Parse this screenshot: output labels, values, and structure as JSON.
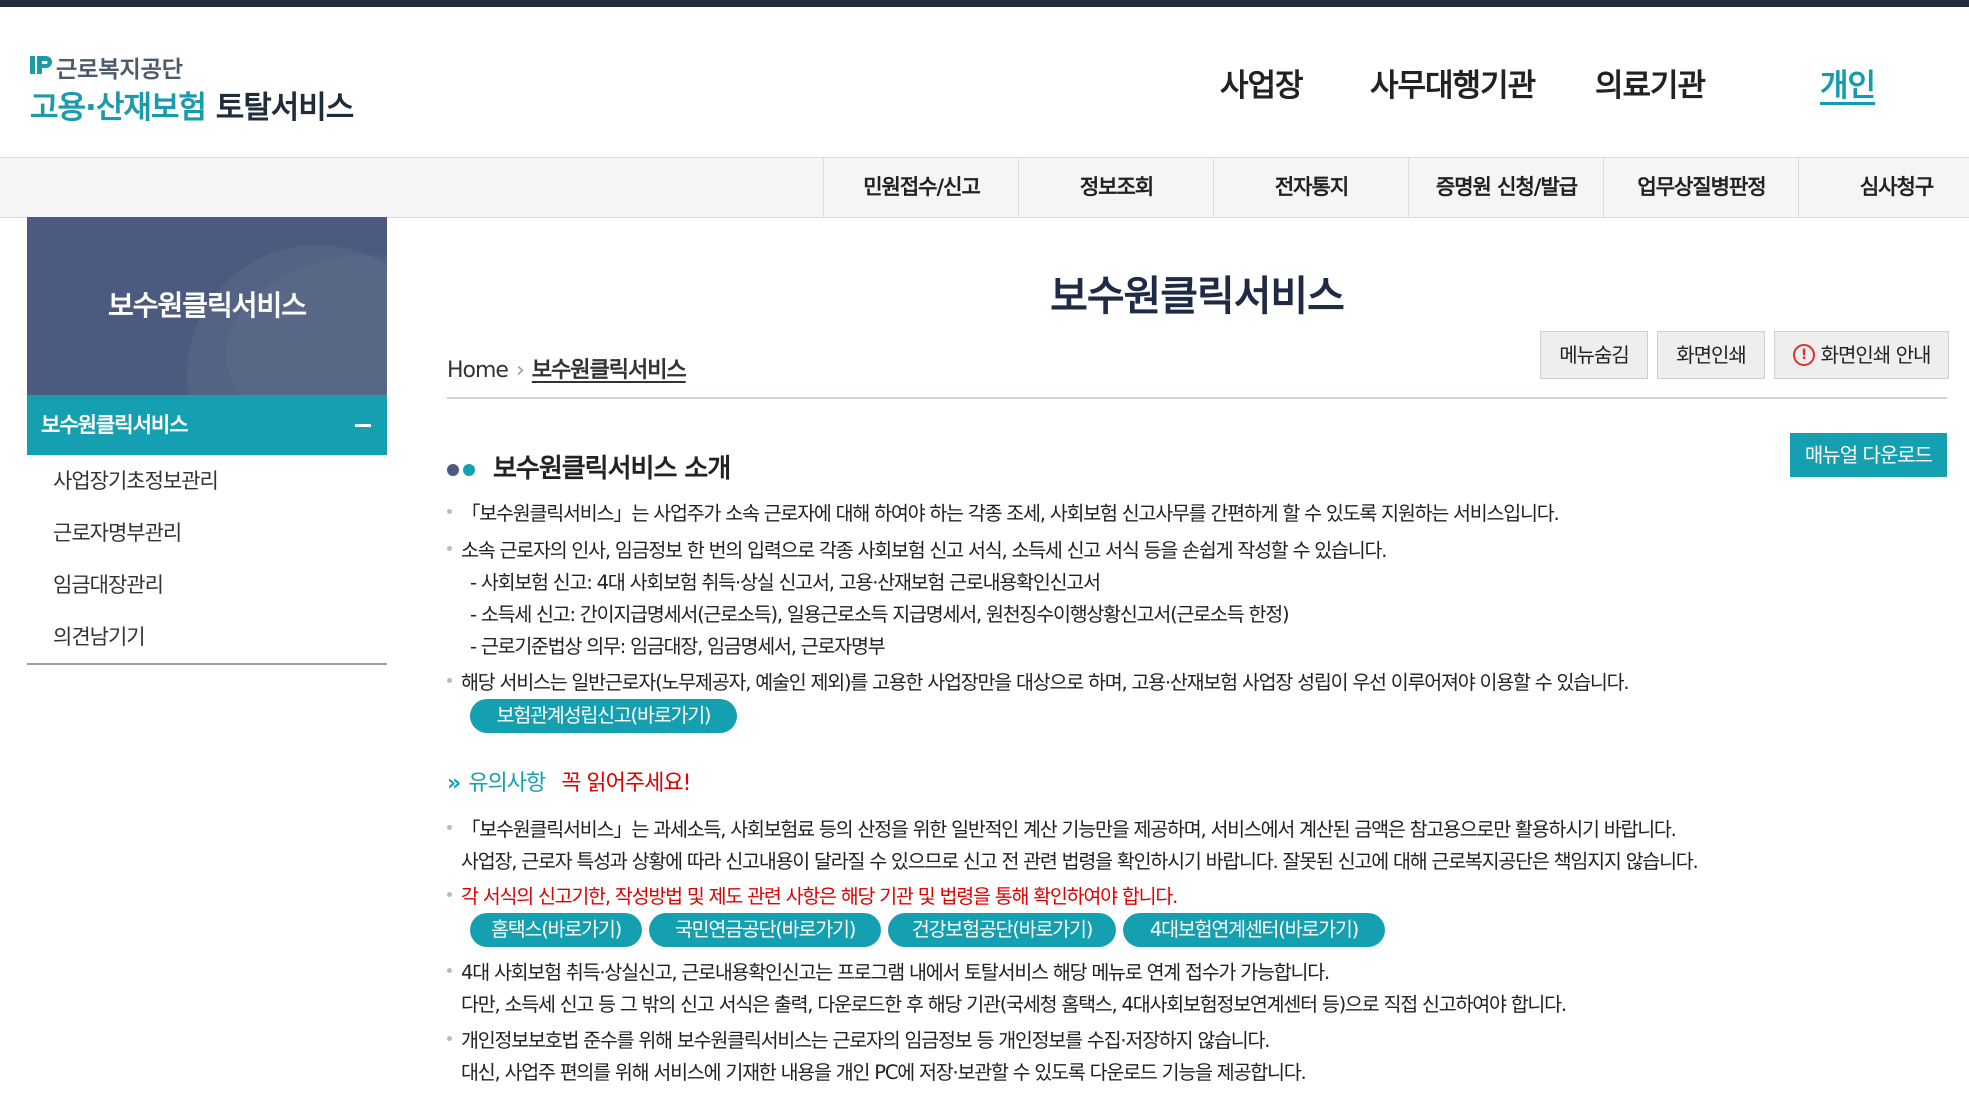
{
  "logo": {
    "org": "근로복지공단",
    "service_main": "고용·산재보험",
    "service_sub": "토탈서비스"
  },
  "top_nav": [
    "사업장",
    "사무대행기관",
    "의료기관",
    "개인"
  ],
  "sub_nav": [
    "민원접수/신고",
    "정보조회",
    "전자통지",
    "증명원 신청/발급",
    "업무상질병판정",
    "심사청구"
  ],
  "sidebar": {
    "title": "보수원클릭서비스",
    "active": "보수원클릭서비스",
    "items": [
      "사업장기초정보관리",
      "근로자명부관리",
      "임금대장관리",
      "의견남기기"
    ]
  },
  "page": {
    "title": "보수원클릭서비스",
    "breadcrumb_home": "Home",
    "breadcrumb_current": "보수원클릭서비스",
    "tools": {
      "hide_menu": "메뉴숨김",
      "print": "화면인쇄",
      "print_guide": "화면인쇄 안내"
    }
  },
  "manual_download": "매뉴얼 다운로드",
  "intro": {
    "title": "보수원클릭서비스 소개",
    "line1": "「보수원클릭서비스」는 사업주가 소속 근로자에 대해 하여야 하는 각종 조세, 사회보험 신고사무를 간편하게 할 수 있도록 지원하는 서비스입니다.",
    "line2": "소속 근로자의 인사, 임금정보 한 번의 입력으로 각종 사회보험 신고 서식, 소득세 신고 서식 등을 손쉽게 작성할 수 있습니다.",
    "sub1": "- 사회보험 신고: 4대 사회보험 취득·상실 신고서, 고용·산재보험 근로내용확인신고서",
    "sub2": "- 소득세 신고: 간이지급명세서(근로소득), 일용근로소득 지급명세서, 원천징수이행상황신고서(근로소득 한정)",
    "sub3": "- 근로기준법상 의무: 임금대장, 임금명세서, 근로자명부",
    "line3": "해당 서비스는 일반근로자(노무제공자, 예술인 제외)를 고용한 사업장만을 대상으로 하며, 고용·산재보험 사업장 성립이 우선 이루어져야 이용할 수 있습니다.",
    "link": "보험관계성립신고(바로가기)"
  },
  "notice": {
    "chevron": "»",
    "title": "유의사항",
    "warning": "꼭 읽어주세요!",
    "p1a": "「보수원클릭서비스」는 과세소득, 사회보험료 등의 산정을 위한 일반적인 계산 기능만을 제공하며, 서비스에서 계산된 금액은 참고용으로만 활용하시기 바랍니다.",
    "p1b": "사업장, 근로자 특성과 상황에 따라 신고내용이 달라질 수 있으므로 신고 전 관련 법령을 확인하시기 바랍니다. 잘못된 신고에 대해 근로복지공단은 책임지지 않습니다.",
    "p2": "각 서식의 신고기한, 작성방법 및 제도 관련 사항은 해당 기관 및 법령을 통해 확인하여야 합니다.",
    "links": [
      "홈택스(바로가기)",
      "국민연금공단(바로가기)",
      "건강보험공단(바로가기)",
      "4대보험연계센터(바로가기)"
    ],
    "p3a": "4대 사회보험 취득·상실신고, 근로내용확인신고는 프로그램 내에서 토탈서비스 해당 메뉴로 연계 접수가 가능합니다.",
    "p3b": "다만, 소득세 신고 등 그 밖의 신고 서식은 출력, 다운로드한 후 해당 기관(국세청 홈택스, 4대사회보험정보연계센터 등)으로 직접 신고하여야 합니다.",
    "p4a": "개인정보보호법 준수를 위해 보수원클릭서비스는 근로자의 임금정보 등 개인정보를 수집·저장하지 않습니다.",
    "p4b": "대신, 사업주 편의를 위해 서비스에 기재한 내용을 개인 PC에 저장·보관할 수 있도록 다운로드 기능을 제공합니다."
  },
  "colors": {
    "accent": "#15a0b2",
    "sidebar_header": "#4b5a7e",
    "warning": "#e00000",
    "title": "#1f2a44"
  }
}
